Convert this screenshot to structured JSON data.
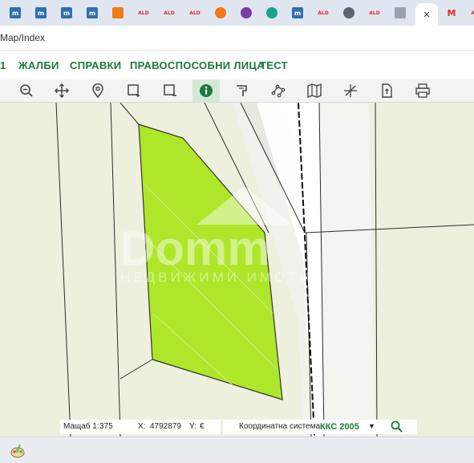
{
  "address": {
    "url": "Map/Index"
  },
  "menu": {
    "items": [
      {
        "label": "ЖАЛБИ"
      },
      {
        "label": "СПРАВКИ"
      },
      {
        "label": "ПРАВОСПОСОБНИ ЛИЦА"
      },
      {
        "label": "ТЕСТ"
      }
    ]
  },
  "tabs": [
    {
      "icon": "m-icon",
      "glyph": "m",
      "color": "#2f6fb0"
    },
    {
      "icon": "m-icon",
      "glyph": "m",
      "color": "#2f6fb0"
    },
    {
      "icon": "m-icon",
      "glyph": "m",
      "color": "#2f6fb0"
    },
    {
      "icon": "m-icon",
      "glyph": "m",
      "color": "#2f6fb0"
    },
    {
      "icon": "orange-icon",
      "glyph": "",
      "color": "#f07a1a"
    },
    {
      "icon": "ald-icon",
      "glyph": "ALD",
      "color": "#e03131"
    },
    {
      "icon": "ald-icon",
      "glyph": "ALD",
      "color": "#e03131"
    },
    {
      "icon": "ald-icon",
      "glyph": "ALD",
      "color": "#e03131"
    },
    {
      "icon": "home-icon",
      "glyph": "",
      "color": "#f07a1a"
    },
    {
      "icon": "purple-icon",
      "glyph": "",
      "color": "#7b3aa6"
    },
    {
      "icon": "teal-icon",
      "glyph": "",
      "color": "#1aa389"
    },
    {
      "icon": "m-icon",
      "glyph": "m",
      "color": "#2f6fb0"
    },
    {
      "icon": "ald-icon",
      "glyph": "ALD",
      "color": "#e03131"
    },
    {
      "icon": "globe-icon",
      "glyph": "",
      "color": "#5c6670"
    },
    {
      "icon": "ald-icon",
      "glyph": "ALD",
      "color": "#e03131"
    },
    {
      "icon": "map-tile-icon",
      "glyph": "",
      "color": "#9aa3ad"
    },
    {
      "icon": "close-icon",
      "glyph": "✕",
      "color": "#333333"
    },
    {
      "icon": "gmail-icon",
      "glyph": "M",
      "color": "#d93025"
    },
    {
      "icon": "ald-icon",
      "glyph": "ALD",
      "color": "#e03131"
    }
  ],
  "toolbar": {
    "tools": [
      "zoom-out-icon",
      "pan-icon",
      "location-pin-icon",
      "select-rect-icon",
      "deselect-rect-icon",
      "info-icon",
      "parcel-icon",
      "node-icon",
      "map-icon",
      "measure-icon",
      "export-icon",
      "print-icon"
    ],
    "active": "info-icon"
  },
  "watermark": {
    "brand": "Domm",
    "tagline": "НЕДВИЖИМИ ИМОТИ"
  },
  "status": {
    "scale_label": "Мащаб 1:",
    "scale_value": "375",
    "x_label": "X:",
    "x_value": "4792879",
    "y_label": "Y:",
    "y_value": "€",
    "crs_label": "Координатна система:",
    "crs_value": "ККС 2005"
  },
  "colors": {
    "accent": "#1b7a3a",
    "parcel": "#aee62a",
    "map_bg": "#eef0de"
  }
}
